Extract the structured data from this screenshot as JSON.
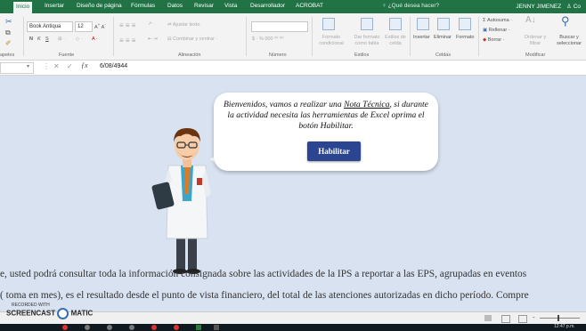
{
  "ribbon_tabs": [
    {
      "label": "Inicio"
    },
    {
      "label": "Insertar"
    },
    {
      "label": "Diseño de página"
    },
    {
      "label": "Fórmulas"
    },
    {
      "label": "Datos"
    },
    {
      "label": "Revisar"
    },
    {
      "label": "Vista"
    },
    {
      "label": "Desarrollador"
    },
    {
      "label": "ACROBAT"
    }
  ],
  "tell_me": "¿Qué desea hacer?",
  "user_name": "JENNY JIMENEZ",
  "share": "Co",
  "ribbon": {
    "font_name": "Book Antiqua",
    "font_size": "12",
    "wrap_text": "Ajustar texto",
    "merge_center": "Combinar y centrar",
    "conditional_format": "Formato condicional",
    "format_as_table": "Dar formato como tabla",
    "cell_styles": "Estilos de celda",
    "insert": "Insertar",
    "delete": "Eliminar",
    "format": "Formato",
    "autosum": "Autosuma",
    "fill": "Rellenar",
    "clear": "Borrar",
    "sort_filter": "Ordenar y filtrar",
    "find_select": "Buscar y seleccionar",
    "groups": {
      "clipboard": "apeles",
      "font": "Fuente",
      "alignment": "Alineación",
      "number": "Número",
      "styles": "Estilos",
      "cells": "Celdas",
      "modify": "Modificar"
    }
  },
  "formula_bar": {
    "value": "6/08/4944"
  },
  "sheet": {
    "welcome_part1": "Bienvenidos, vamos a realizar una",
    "welcome_link": "Nota Técnica",
    "welcome_part2": ", si durante la actividad necesita las herramientas de Excel oprima el botón Habilitar.",
    "enable_button": "Habilitar",
    "paragraph_line1": "e, usted podrá consultar toda la información consignada sobre las actividades de la IPS a reportar a las EPS, agrupadas en eventos",
    "paragraph_line2": "( toma en mes), es el resultado desde el punto de vista financiero, del total de las atenciones autorizadas en dicho período. Compre"
  },
  "watermark": {
    "recorded_with": "RECORDED WITH",
    "brand_left": "SCREENCAST",
    "brand_right": "MATIC"
  },
  "taskbar": {
    "time": "12:47 p.m."
  },
  "colors": {
    "excel_green": "#217346",
    "sheet_background": "#d8e2f0",
    "button": "#2b4590"
  }
}
